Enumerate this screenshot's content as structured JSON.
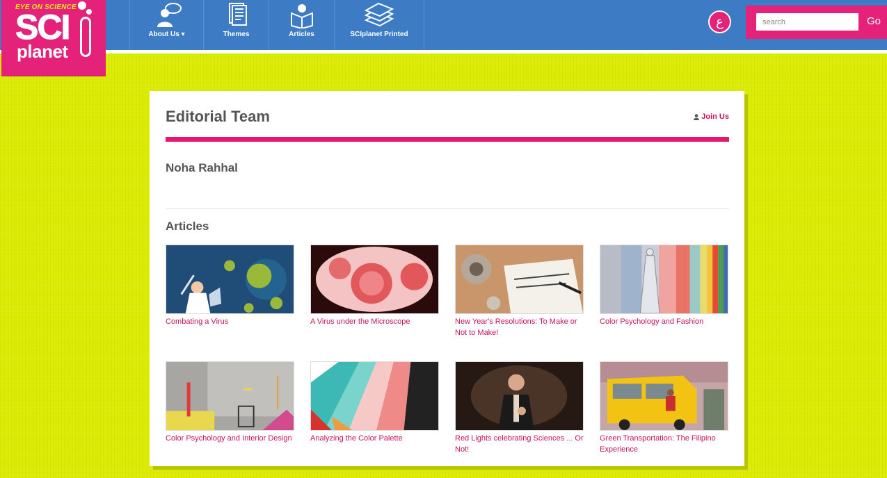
{
  "brand": {
    "tagline": "EYE ON SCIENCE",
    "logo_main": "SCI",
    "logo_sub": "planet"
  },
  "nav": {
    "items": [
      {
        "label": "About Us ▾",
        "icon": "person-speech-icon"
      },
      {
        "label": "Themes",
        "icon": "document-icon"
      },
      {
        "label": "Articles",
        "icon": "reader-icon"
      },
      {
        "label": "SCIplanet Printed",
        "icon": "stacked-papers-icon"
      }
    ]
  },
  "language": {
    "label": "ع"
  },
  "search": {
    "placeholder": "search",
    "button_label": "Go"
  },
  "page": {
    "title": "Editorial Team",
    "join_label": "Join Us",
    "author_name": "Noha Rahhal",
    "section_title": "Articles"
  },
  "articles": [
    {
      "title": "Combating a Virus"
    },
    {
      "title": "A Virus under the Microscope"
    },
    {
      "title": "New Year's Resolutions: To Make or Not to Make!"
    },
    {
      "title": "Color Psychology and Fashion"
    },
    {
      "title": "Color Psychology and Interior Design"
    },
    {
      "title": "Analyzing the Color Palette"
    },
    {
      "title": "Red Lights celebrating Sciences ... Or Not!"
    },
    {
      "title": "Green Transportation: The Filipino Experience"
    }
  ],
  "colors": {
    "brand_pink": "#e5227a",
    "nav_blue": "#3d7bc4",
    "background_lime": "#dcec00",
    "link_magenta": "#c5125e",
    "heading_gray": "#555555"
  }
}
